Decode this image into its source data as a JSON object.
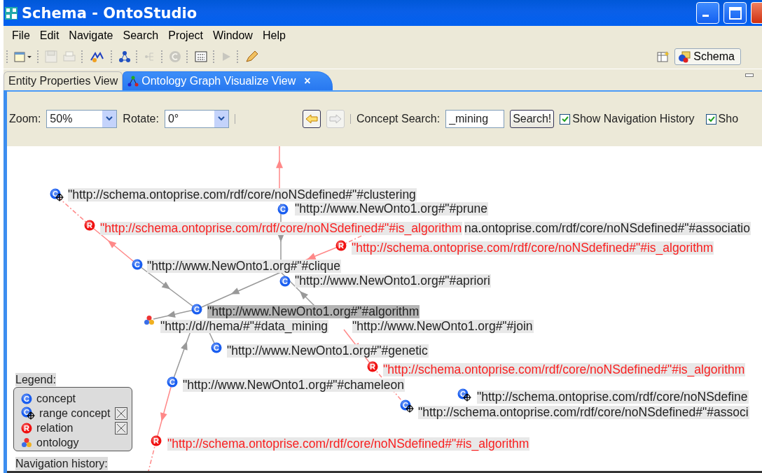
{
  "window": {
    "title": "Schema - OntoStudio"
  },
  "menu": [
    "File",
    "Edit",
    "Navigate",
    "Search",
    "Project",
    "Window",
    "Help"
  ],
  "toolbar": [
    {
      "disabled": false
    },
    {
      "disabled": true
    },
    {
      "disabled": true
    },
    {
      "disabled": false
    },
    {
      "disabled": false
    },
    {
      "disabled": true
    },
    {
      "disabled": true
    },
    {
      "disabled": false
    },
    {
      "disabled": true
    },
    {
      "disabled": false
    }
  ],
  "perspective": {
    "label": "Schema"
  },
  "tabs": [
    {
      "label": "Entity Properties View",
      "selected": false
    },
    {
      "label": "Ontology Graph Visualize View",
      "selected": true,
      "close": "×"
    }
  ],
  "controls": {
    "zoom_label": "Zoom:",
    "zoom_value": "50%",
    "rotate_label": "Rotate:",
    "rotate_value": "0°",
    "back_disabled": false,
    "forward_disabled": true,
    "search_label": "Concept Search:",
    "search_value": "_mining",
    "search_button": "Search!",
    "checkboxes": [
      {
        "label": "Show Navigation History",
        "checked": true
      },
      {
        "label": "Sho",
        "checked": true
      }
    ]
  },
  "graph": {
    "nodes": [
      {
        "kind": "range_concept",
        "badge": "C",
        "label": "\"http://schema.ontoprise.com/rdf/core/noNSdefined#\"#clustering",
        "selected": false
      },
      {
        "kind": "concept",
        "badge": "C",
        "label": "\"http://www.NewOnto1.org#\"#prune",
        "selected": false
      },
      {
        "kind": "relation",
        "badge": "R",
        "label": "\"http://schema.ontoprise.com/rdf/core/noNSdefined#\"#is_algorithm",
        "selected": false
      },
      {
        "kind": "fragment",
        "label": "na.ontoprise.com/rdf/core/noNSdefined#\"#associatio",
        "selected": false
      },
      {
        "kind": "relation",
        "badge": "R",
        "label": "\"http://schema.ontoprise.com/rdf/core/noNSdefined#\"#is_algorithm",
        "selected": false
      },
      {
        "kind": "concept",
        "badge": "C",
        "label": "\"http://www.NewOnto1.org#\"#clique",
        "selected": false
      },
      {
        "kind": "concept",
        "badge": "C",
        "label": "\"http://www.NewOnto1.org#\"#apriori",
        "selected": false
      },
      {
        "kind": "concept",
        "badge": "C",
        "label": "\"http://www.NewOnto1.org#\"#algorithm",
        "selected": true
      },
      {
        "kind": "ontology",
        "label": "\"http://d//hema/#\"#data_mining",
        "selected": false
      },
      {
        "kind": "fragment",
        "label": "\"http://www.NewOnto1.org#\"#join",
        "selected": false
      },
      {
        "kind": "concept",
        "badge": "C",
        "label": "\"http://www.NewOnto1.org#\"#genetic",
        "selected": false
      },
      {
        "kind": "relation",
        "badge": "R",
        "label": "\"http://schema.ontoprise.com/rdf/core/noNSdefined#\"#is_algorithm",
        "selected": false
      },
      {
        "kind": "concept",
        "badge": "C",
        "label": "\"http://www.NewOnto1.org#\"#chameleon",
        "selected": false
      },
      {
        "kind": "range_concept",
        "badge": "C",
        "label": "\"http://schema.ontoprise.com/rdf/core/noNSdefine",
        "selected": false
      },
      {
        "kind": "range_concept",
        "badge": "C",
        "label": "\"http://schema.ontoprise.com/rdf/core/noNSdefined#\"#associ",
        "selected": false
      },
      {
        "kind": "relation",
        "badge": "R",
        "label": "\"http://schema.ontoprise.com/rdf/core/noNSdefined#\"#is_algorithm",
        "selected": false
      }
    ],
    "legend": {
      "title": "Legend:",
      "items": [
        {
          "kind": "concept",
          "badge": "C",
          "label": "concept"
        },
        {
          "kind": "range_concept",
          "badge": "C",
          "label": "range concept",
          "checked": true
        },
        {
          "kind": "relation",
          "badge": "R",
          "label": "relation",
          "checked": true
        },
        {
          "kind": "ontology",
          "label": "ontology"
        }
      ]
    },
    "navigation_history": {
      "title": "Navigation history:"
    }
  }
}
